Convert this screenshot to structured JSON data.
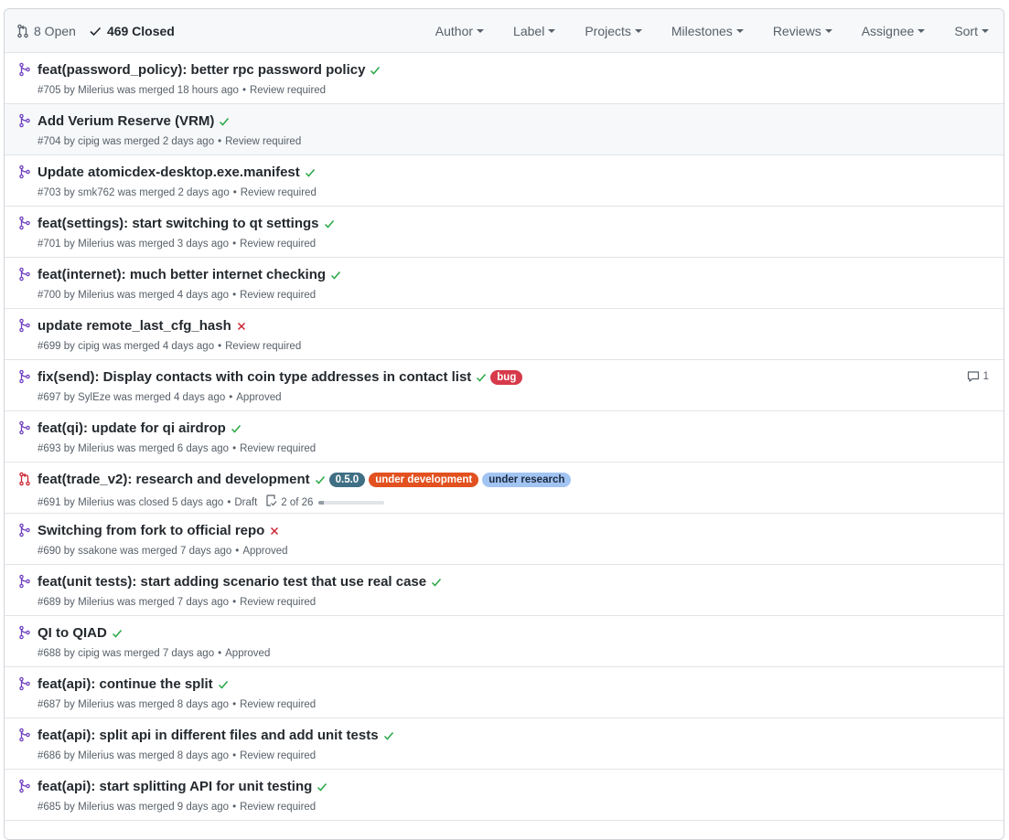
{
  "header": {
    "open_count": "8 Open",
    "closed_count": "469 Closed",
    "filters": [
      "Author",
      "Label",
      "Projects",
      "Milestones",
      "Reviews",
      "Assignee",
      "Sort"
    ]
  },
  "colors": {
    "merged": "#6f42c1",
    "closed": "#cb2431",
    "success": "#28a745",
    "failure": "#cb2431"
  },
  "pulls": [
    {
      "title": "feat(password_policy): better rpc password policy",
      "state": "merged",
      "status": "success",
      "number": "#705",
      "author": "Milerius",
      "action": "was merged",
      "time": "18 hours ago",
      "review": "Review required",
      "labels": [],
      "comments": null,
      "tasks": null
    },
    {
      "title": "Add Verium Reserve (VRM)",
      "state": "merged",
      "status": "success",
      "number": "#704",
      "author": "cipig",
      "action": "was merged",
      "time": "2 days ago",
      "review": "Review required",
      "labels": [],
      "comments": null,
      "tasks": null,
      "hover": true
    },
    {
      "title": "Update atomicdex-desktop.exe.manifest",
      "state": "merged",
      "status": "success",
      "number": "#703",
      "author": "smk762",
      "action": "was merged",
      "time": "2 days ago",
      "review": "Review required",
      "labels": [],
      "comments": null,
      "tasks": null
    },
    {
      "title": "feat(settings): start switching to qt settings",
      "state": "merged",
      "status": "success",
      "number": "#701",
      "author": "Milerius",
      "action": "was merged",
      "time": "3 days ago",
      "review": "Review required",
      "labels": [],
      "comments": null,
      "tasks": null
    },
    {
      "title": "feat(internet): much better internet checking",
      "state": "merged",
      "status": "success",
      "number": "#700",
      "author": "Milerius",
      "action": "was merged",
      "time": "4 days ago",
      "review": "Review required",
      "labels": [],
      "comments": null,
      "tasks": null
    },
    {
      "title": "update remote_last_cfg_hash",
      "state": "merged",
      "status": "failure",
      "number": "#699",
      "author": "cipig",
      "action": "was merged",
      "time": "4 days ago",
      "review": "Review required",
      "labels": [],
      "comments": null,
      "tasks": null
    },
    {
      "title": "fix(send): Display contacts with coin type addresses in contact list",
      "state": "merged",
      "status": "success",
      "number": "#697",
      "author": "SylEze",
      "action": "was merged",
      "time": "4 days ago",
      "review": "Approved",
      "labels": [
        {
          "name": "bug",
          "bg": "#d73a4a",
          "fg": "#ffffff"
        }
      ],
      "comments": "1",
      "tasks": null
    },
    {
      "title": "feat(qi): update for qi airdrop",
      "state": "merged",
      "status": "success",
      "number": "#693",
      "author": "Milerius",
      "action": "was merged",
      "time": "6 days ago",
      "review": "Review required",
      "labels": [],
      "comments": null,
      "tasks": null
    },
    {
      "title": "feat(trade_v2): research and development",
      "state": "closed",
      "status": "success",
      "number": "#691",
      "author": "Milerius",
      "action": "was closed",
      "time": "5 days ago",
      "review": "Draft",
      "labels": [
        {
          "name": "0.5.0",
          "bg": "#3f6f84",
          "fg": "#ffffff"
        },
        {
          "name": "under development",
          "bg": "#e2511f",
          "fg": "#ffffff"
        },
        {
          "name": "under research",
          "bg": "#a2c4f2",
          "fg": "#1b2a40"
        }
      ],
      "comments": null,
      "tasks": {
        "text": "2 of 26",
        "fraction": 0.077
      }
    },
    {
      "title": "Switching from fork to official repo",
      "state": "merged",
      "status": "failure",
      "number": "#690",
      "author": "ssakone",
      "action": "was merged",
      "time": "7 days ago",
      "review": "Approved",
      "labels": [],
      "comments": null,
      "tasks": null
    },
    {
      "title": "feat(unit tests): start adding scenario test that use real case",
      "state": "merged",
      "status": "success",
      "number": "#689",
      "author": "Milerius",
      "action": "was merged",
      "time": "7 days ago",
      "review": "Review required",
      "labels": [],
      "comments": null,
      "tasks": null
    },
    {
      "title": "QI to QIAD",
      "state": "merged",
      "status": "success",
      "number": "#688",
      "author": "cipig",
      "action": "was merged",
      "time": "7 days ago",
      "review": "Approved",
      "labels": [],
      "comments": null,
      "tasks": null
    },
    {
      "title": "feat(api): continue the split",
      "state": "merged",
      "status": "success",
      "number": "#687",
      "author": "Milerius",
      "action": "was merged",
      "time": "8 days ago",
      "review": "Review required",
      "labels": [],
      "comments": null,
      "tasks": null
    },
    {
      "title": "feat(api): split api in different files and add unit tests",
      "state": "merged",
      "status": "success",
      "number": "#686",
      "author": "Milerius",
      "action": "was merged",
      "time": "8 days ago",
      "review": "Review required",
      "labels": [],
      "comments": null,
      "tasks": null
    },
    {
      "title": "feat(api): start splitting API for unit testing",
      "state": "merged",
      "status": "success",
      "number": "#685",
      "author": "Milerius",
      "action": "was merged",
      "time": "9 days ago",
      "review": "Review required",
      "labels": [],
      "comments": null,
      "tasks": null
    }
  ]
}
